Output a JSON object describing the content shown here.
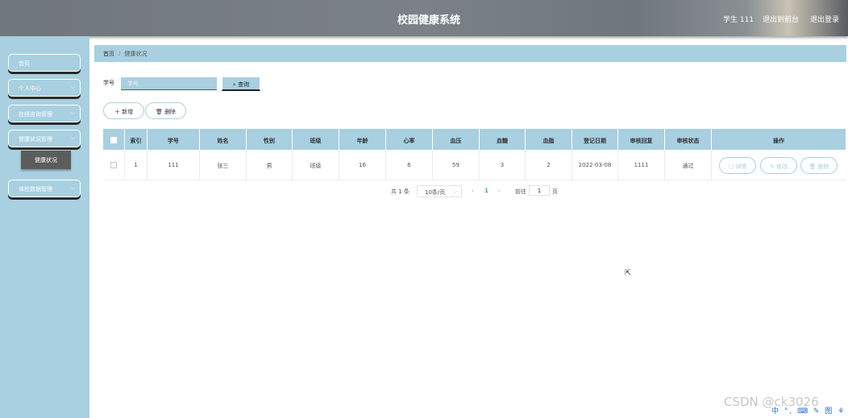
{
  "header": {
    "title": "校园健康系统",
    "user": "学生 111",
    "back_to_front": "退出到前台",
    "logout": "退出登录"
  },
  "sidebar": {
    "items": [
      {
        "label": "首页",
        "expandable": false
      },
      {
        "label": "个人中心",
        "expandable": true
      },
      {
        "label": "在线咨询管理",
        "expandable": true
      },
      {
        "label": "健康状况管理",
        "expandable": true
      },
      {
        "label": "体检数据管理",
        "expandable": true
      }
    ],
    "active_sub": "健康状况",
    "chevron": "chevron-down-icon"
  },
  "breadcrumb": {
    "home": "首页",
    "separator": "/",
    "current": "健康状况"
  },
  "search": {
    "label": "学号",
    "placeholder": "学号",
    "value": "",
    "button": "查询",
    "button_icon": "search-icon"
  },
  "actions": {
    "add": "新增",
    "add_icon": "plus-icon",
    "delete": "删除",
    "delete_icon": "trash-icon"
  },
  "table": {
    "columns": [
      "",
      "索引",
      "学号",
      "姓名",
      "性别",
      "班级",
      "年龄",
      "心率",
      "血压",
      "血糖",
      "血脂",
      "登记日期",
      "审核回复",
      "审核状态",
      "操作"
    ],
    "rows": [
      {
        "cells": [
          "",
          "1",
          "111",
          "张三",
          "男",
          "班级",
          "16",
          "6",
          "59",
          "3",
          "2",
          "2022-03-08",
          "1111",
          "通过"
        ]
      }
    ],
    "row_actions": {
      "detail": "详情",
      "edit": "修改",
      "delete": "删除"
    }
  },
  "pagination": {
    "total": "共 1 条",
    "page_size": "10条/页",
    "prev": "‹",
    "current_page": "1",
    "next": "›",
    "goto_label": "前往",
    "goto_value": "1",
    "page_suffix": "页"
  },
  "watermark": "CSDN @ck3026",
  "ime_toolbar": "中 °, ⌨ ✎ 图 ⚘",
  "colors": {
    "accent": "#a8d0e0",
    "header": "#757c82",
    "sub_active": "#5c5c5c"
  }
}
